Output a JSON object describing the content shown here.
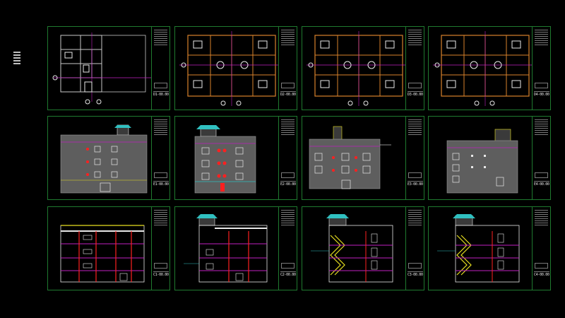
{
  "canvas": {
    "background": "#000000"
  },
  "colors": {
    "frame": "#1f7a2f",
    "wall": "#c8c8c8",
    "accent_orange": "#d9822b",
    "accent_magenta": "#c020c0",
    "accent_red": "#ff2020",
    "accent_yellow": "#e8e020",
    "accent_cyan": "#30c0c0"
  },
  "sheets": [
    {
      "kind": "floor-plan",
      "code": "D1-00.00"
    },
    {
      "kind": "floor-plan",
      "code": "D2-00.00"
    },
    {
      "kind": "floor-plan",
      "code": "D3-00.00"
    },
    {
      "kind": "floor-plan",
      "code": "D4-00.00"
    },
    {
      "kind": "elevation",
      "code": "E1-00.00"
    },
    {
      "kind": "elevation",
      "code": "E2-00.00"
    },
    {
      "kind": "elevation",
      "code": "E3-00.00"
    },
    {
      "kind": "elevation",
      "code": "E4-00.00"
    },
    {
      "kind": "section",
      "code": "C1-00.00"
    },
    {
      "kind": "section",
      "code": "C2-00.00"
    },
    {
      "kind": "section",
      "code": "C3-00.00"
    },
    {
      "kind": "section",
      "code": "C4-00.00"
    }
  ]
}
